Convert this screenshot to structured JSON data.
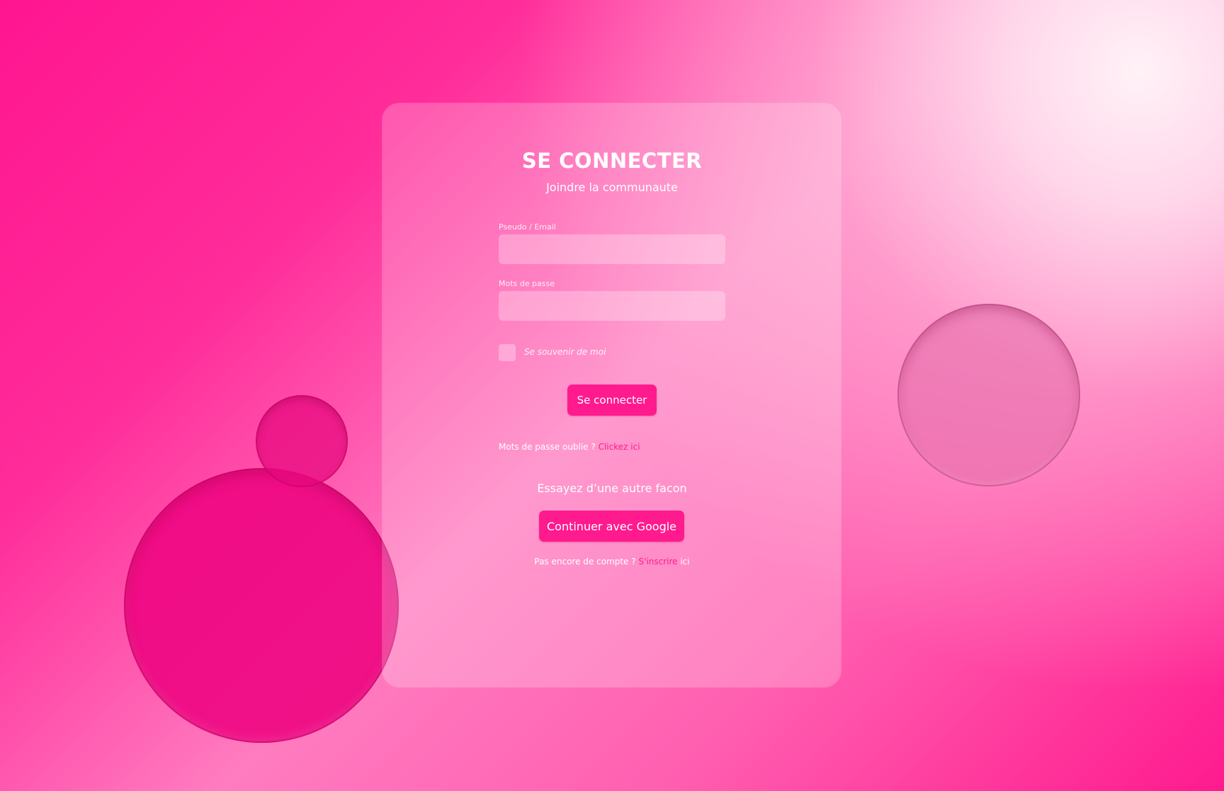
{
  "login": {
    "title": "SE CONNECTER",
    "subtitle": "Joindre la communaute",
    "username_label": "Pseudo / Email",
    "username_value": "",
    "password_label": "Mots de passe",
    "password_value": "",
    "remember_label": "Se souvenir de moi",
    "submit_label": "Se connecter",
    "forgot_text": "Mots de passe oublie ?",
    "forgot_link": "Clickez ici",
    "alt_heading": "Essayez d’une autre facon",
    "google_label": "Continuer avec Google",
    "signup_text": "Pas encore de compte ?",
    "signup_link": "S'inscrire",
    "signup_suffix": "ici"
  },
  "colors": {
    "accent": "#ff1a8e",
    "background_primary": "#ff1590",
    "background_highlight": "#fff2f7"
  }
}
